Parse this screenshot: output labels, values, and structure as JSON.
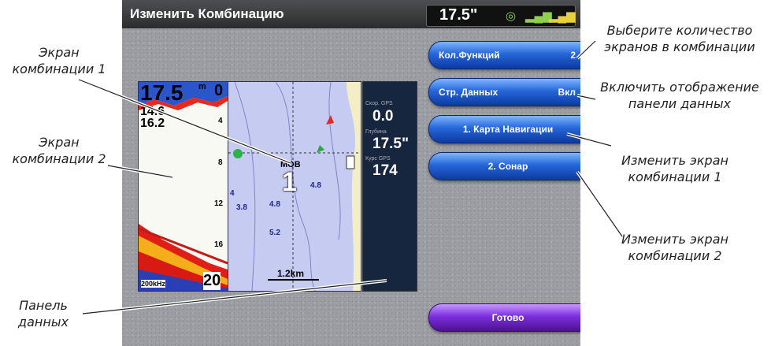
{
  "device": {
    "title": "Изменить Комбинацию",
    "depth": "17.5\"",
    "menu": [
      {
        "label": "Кол.Функций",
        "value": "2"
      },
      {
        "label": "Стр. Данных",
        "value": "Вкл"
      },
      {
        "label": "1. Карта Навигации",
        "value": ""
      },
      {
        "label": "2. Сонар",
        "value": ""
      }
    ],
    "done": "Готово",
    "sonar": {
      "depth": "17.5",
      "unit": "m",
      "range_top": "0",
      "reading1": "14.6",
      "reading2": "16.2",
      "t4": "4",
      "t8": "8",
      "t12": "12",
      "t16": "16",
      "range_bottom": "20",
      "freq": "200kHz"
    },
    "chart": {
      "mob": "MOB",
      "label_1": "1",
      "scale": "1.2km",
      "depths": [
        "4",
        "3.8",
        "4.8",
        "4.8",
        "5.2"
      ]
    },
    "data_panel": {
      "l1": "Скор. GPS",
      "v1": "0.0",
      "l2": "Глубина",
      "v2": "17.5\"",
      "l3": "Курс GPS",
      "v3": "174"
    }
  },
  "callouts": {
    "left1": [
      "Экран",
      "комбинации 1"
    ],
    "left2": [
      "Экран",
      "комбинации 2"
    ],
    "left3": [
      "Панель",
      "данных"
    ],
    "right1": [
      "Выберите количество",
      "экранов в комбинации"
    ],
    "right2": [
      "Включить отображение",
      "панели данных"
    ],
    "right3": [
      "Изменить экран",
      "комбинации 1"
    ],
    "right4": [
      "Изменить экран",
      "комбинации 2"
    ]
  }
}
